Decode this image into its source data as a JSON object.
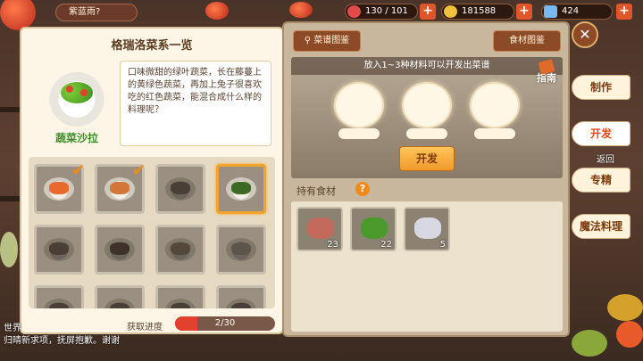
{
  "topbar": {
    "username": "紫蓝雨?",
    "stamina": "130 / 101",
    "coins": "181588",
    "gems": "424",
    "plus_label": "+"
  },
  "left_panel": {
    "title": "格瑞洛菜系一览",
    "dish_name": "蔬菜沙拉",
    "description": "口味微甜的绿叶蔬菜，长在藤蔓上的黄绿色蔬菜，再加上兔子很喜欢吃的红色蔬菜，能混合成什么样的料理呢？",
    "progress_label": "获取进度",
    "progress_text": "2/30",
    "progress_value": 0.0667,
    "dishes": [
      {
        "name": "dish-1",
        "obtained": true,
        "selected": false,
        "locked": false,
        "color": "#e8692e"
      },
      {
        "name": "dish-2",
        "obtained": true,
        "selected": false,
        "locked": false,
        "color": "#d3763a"
      },
      {
        "name": "dish-3",
        "obtained": false,
        "selected": false,
        "locked": true,
        "color": "#4a3f36"
      },
      {
        "name": "dish-4",
        "obtained": false,
        "selected": true,
        "locked": false,
        "color": "#3c6a25"
      },
      {
        "name": "dish-5",
        "obtained": false,
        "selected": false,
        "locked": true,
        "color": "#4a3f36"
      },
      {
        "name": "dish-6",
        "obtained": false,
        "selected": false,
        "locked": true,
        "color": "#3e322a"
      },
      {
        "name": "dish-7",
        "obtained": false,
        "selected": false,
        "locked": true,
        "color": "#54483c"
      },
      {
        "name": "dish-8",
        "obtained": false,
        "selected": false,
        "locked": true,
        "color": "#5c554c"
      },
      {
        "name": "dish-9",
        "obtained": false,
        "selected": false,
        "locked": true,
        "color": "#4a3f36"
      },
      {
        "name": "dish-10",
        "obtained": false,
        "selected": false,
        "locked": true,
        "color": "#4a3f36"
      },
      {
        "name": "dish-11",
        "obtained": false,
        "selected": false,
        "locked": true,
        "color": "#4a3f36"
      },
      {
        "name": "dish-12",
        "obtained": false,
        "selected": false,
        "locked": true,
        "color": "#4a3f36"
      }
    ]
  },
  "right_panel": {
    "recipe_tab": "菜谱图鉴",
    "ingredient_tab": "食材图鉴",
    "hint": "放入1~3种材料可以开发出菜谱",
    "guide": "指南",
    "develop_button": "开发",
    "owned_label": "持有食材",
    "help_icon": "?",
    "ingredients": [
      {
        "name": "meat",
        "count": "23",
        "color": "#c46a5c"
      },
      {
        "name": "green-pepper",
        "count": "22",
        "color": "#4a9a2c"
      },
      {
        "name": "oyster",
        "count": "5",
        "color": "#d8d8e2"
      }
    ]
  },
  "side_nav": {
    "make": "制作",
    "develop": "开发",
    "back": "返回",
    "specialize": "专精",
    "magic_cooking": "魔法料理"
  },
  "chat": {
    "line1": "世界",
    "line2": "归晴新求项，抚屏抱歉。谢谢"
  },
  "colors": {
    "accent": "#f08a1a",
    "button_brown": "#8d4a26",
    "dish_name_green": "#3e8d2c",
    "progress_red": "#e2412d"
  }
}
